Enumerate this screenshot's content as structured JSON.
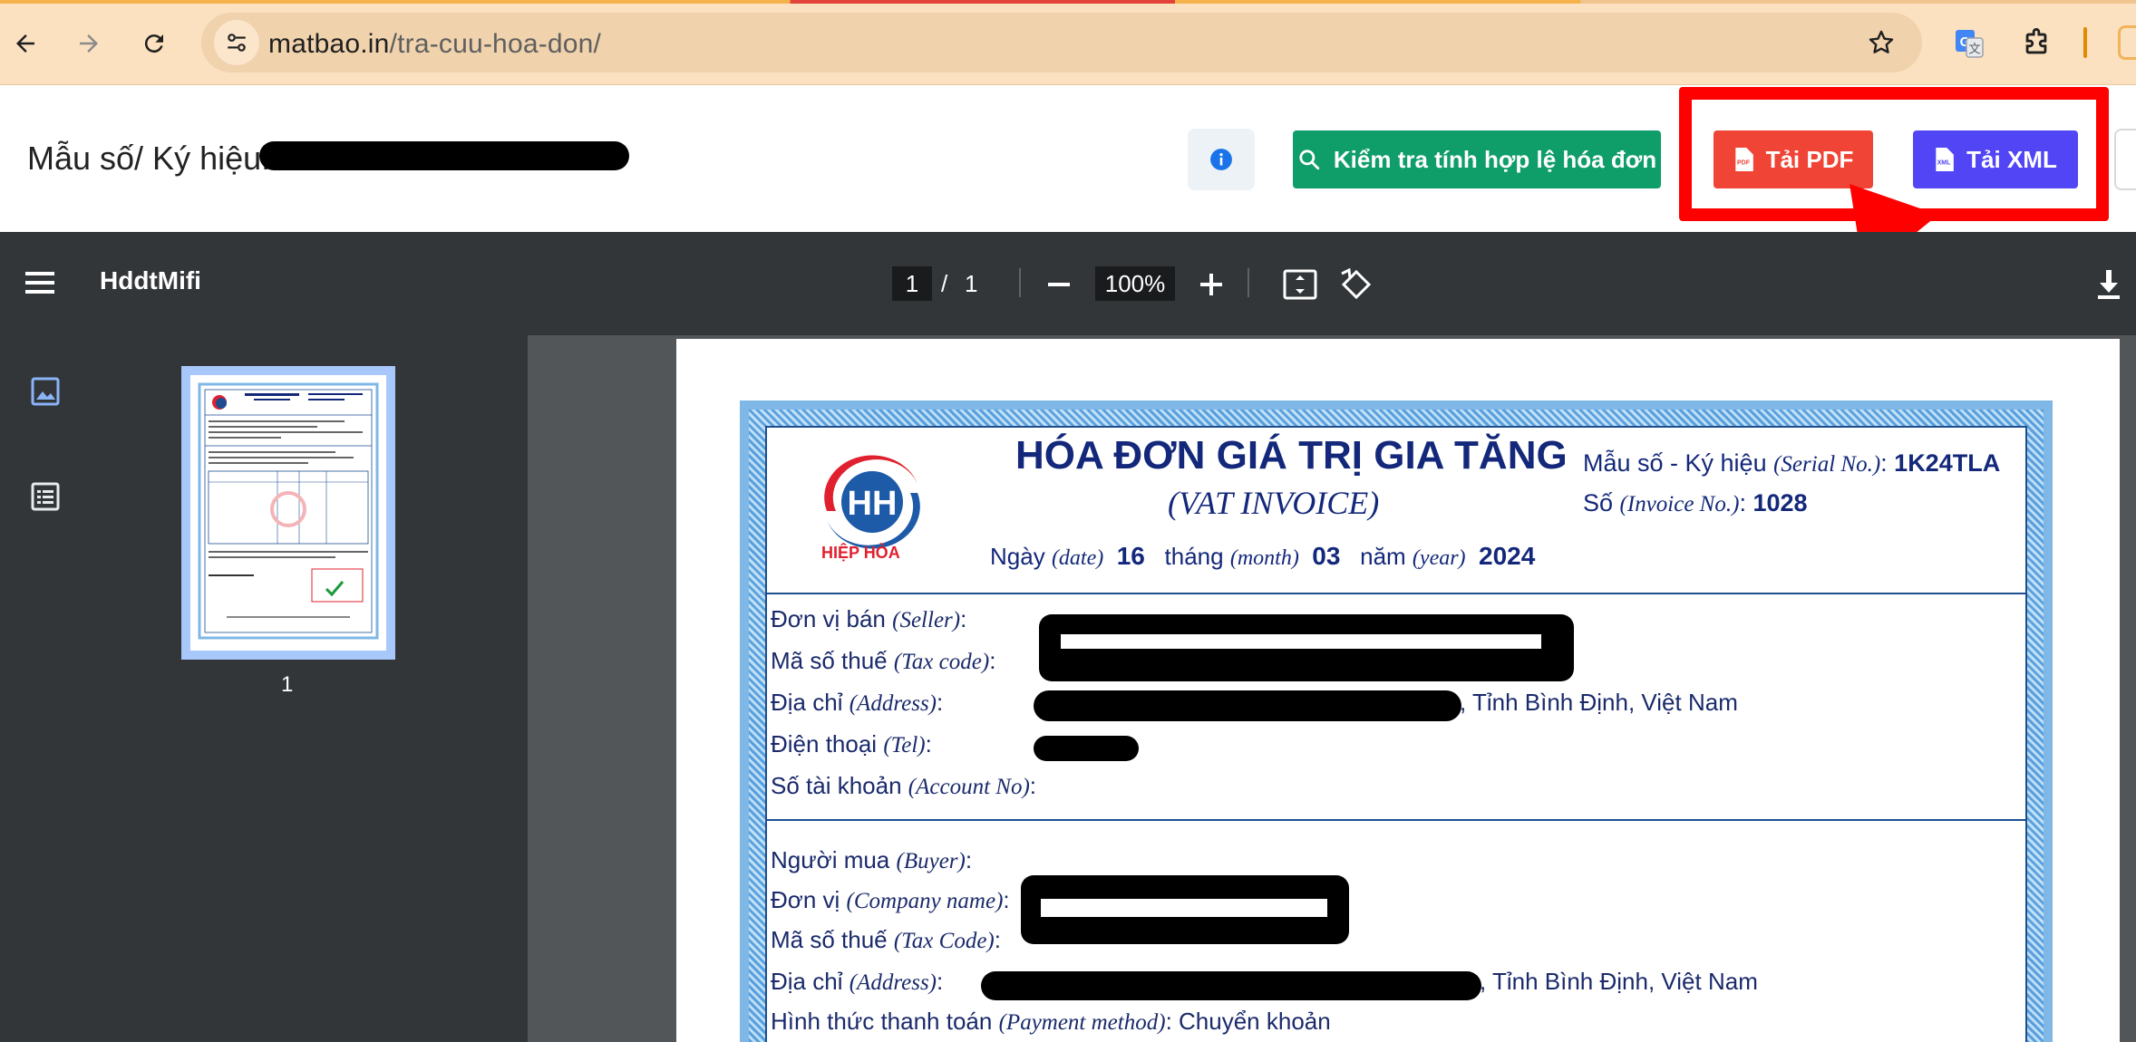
{
  "browser": {
    "url_host": "matbao.in",
    "url_path": "/tra-cuu-hoa-don/"
  },
  "header": {
    "serial_label": "Mẫu số/ Ký hiệu:",
    "verify_button": "Kiểm tra tính hợp lệ hóa đơn",
    "pdf_button": "Tải PDF",
    "xml_button": "Tải XML"
  },
  "viewer": {
    "title": "HddtMifi",
    "page_current": "1",
    "page_separator": "/",
    "page_total": "1",
    "zoom": "100%",
    "thumbnail_label": "1"
  },
  "invoice": {
    "title": "HÓA ĐƠN GIÁ TRỊ GIA TĂNG",
    "subtitle": "(VAT INVOICE)",
    "logo_text": "HIỆP HÒA",
    "date_label": "Ngày",
    "date_label_en": "(date)",
    "day": "16",
    "month_label": "tháng",
    "month_label_en": "(month)",
    "month": "03",
    "year_label": "năm",
    "year_label_en": "(year)",
    "year": "2024",
    "serial_label": "Mẫu số - Ký hiệu",
    "serial_label_en": "(Serial No.)",
    "serial_value": "1K24TLA",
    "number_label": "Số",
    "number_label_en": "(Invoice No.)",
    "number_value": "1028",
    "seller": {
      "name_label": "Đơn vị bán",
      "name_label_en": "(Seller)",
      "tax_label": "Mã số thuế",
      "tax_label_en": "(Tax code)",
      "address_label": "Địa chỉ",
      "address_label_en": "(Address)",
      "address_tail": ", Tỉnh Bình Định, Việt Nam",
      "tel_label": "Điện thoại",
      "tel_label_en": "(Tel)",
      "account_label": "Số tài khoản",
      "account_label_en": "(Account No)"
    },
    "buyer": {
      "buyer_label": "Người mua",
      "buyer_label_en": "(Buyer)",
      "company_label": "Đơn vị",
      "company_label_en": "(Company name)",
      "tax_label": "Mã số thuế",
      "tax_label_en": "(Tax Code)",
      "address_label": "Địa chỉ",
      "address_label_en": "(Address)",
      "address_tail": ", Tỉnh Bình Định, Việt Nam",
      "payment_label": "Hình thức thanh toán",
      "payment_label_en": "(Payment method)",
      "payment_value": "Chuyển khoản"
    }
  },
  "colors": {
    "verify": "#0f9d6a",
    "pdf": "#f04436",
    "xml": "#5145f5",
    "highlight": "#ff0000",
    "invoice_ink": "#13287a"
  }
}
